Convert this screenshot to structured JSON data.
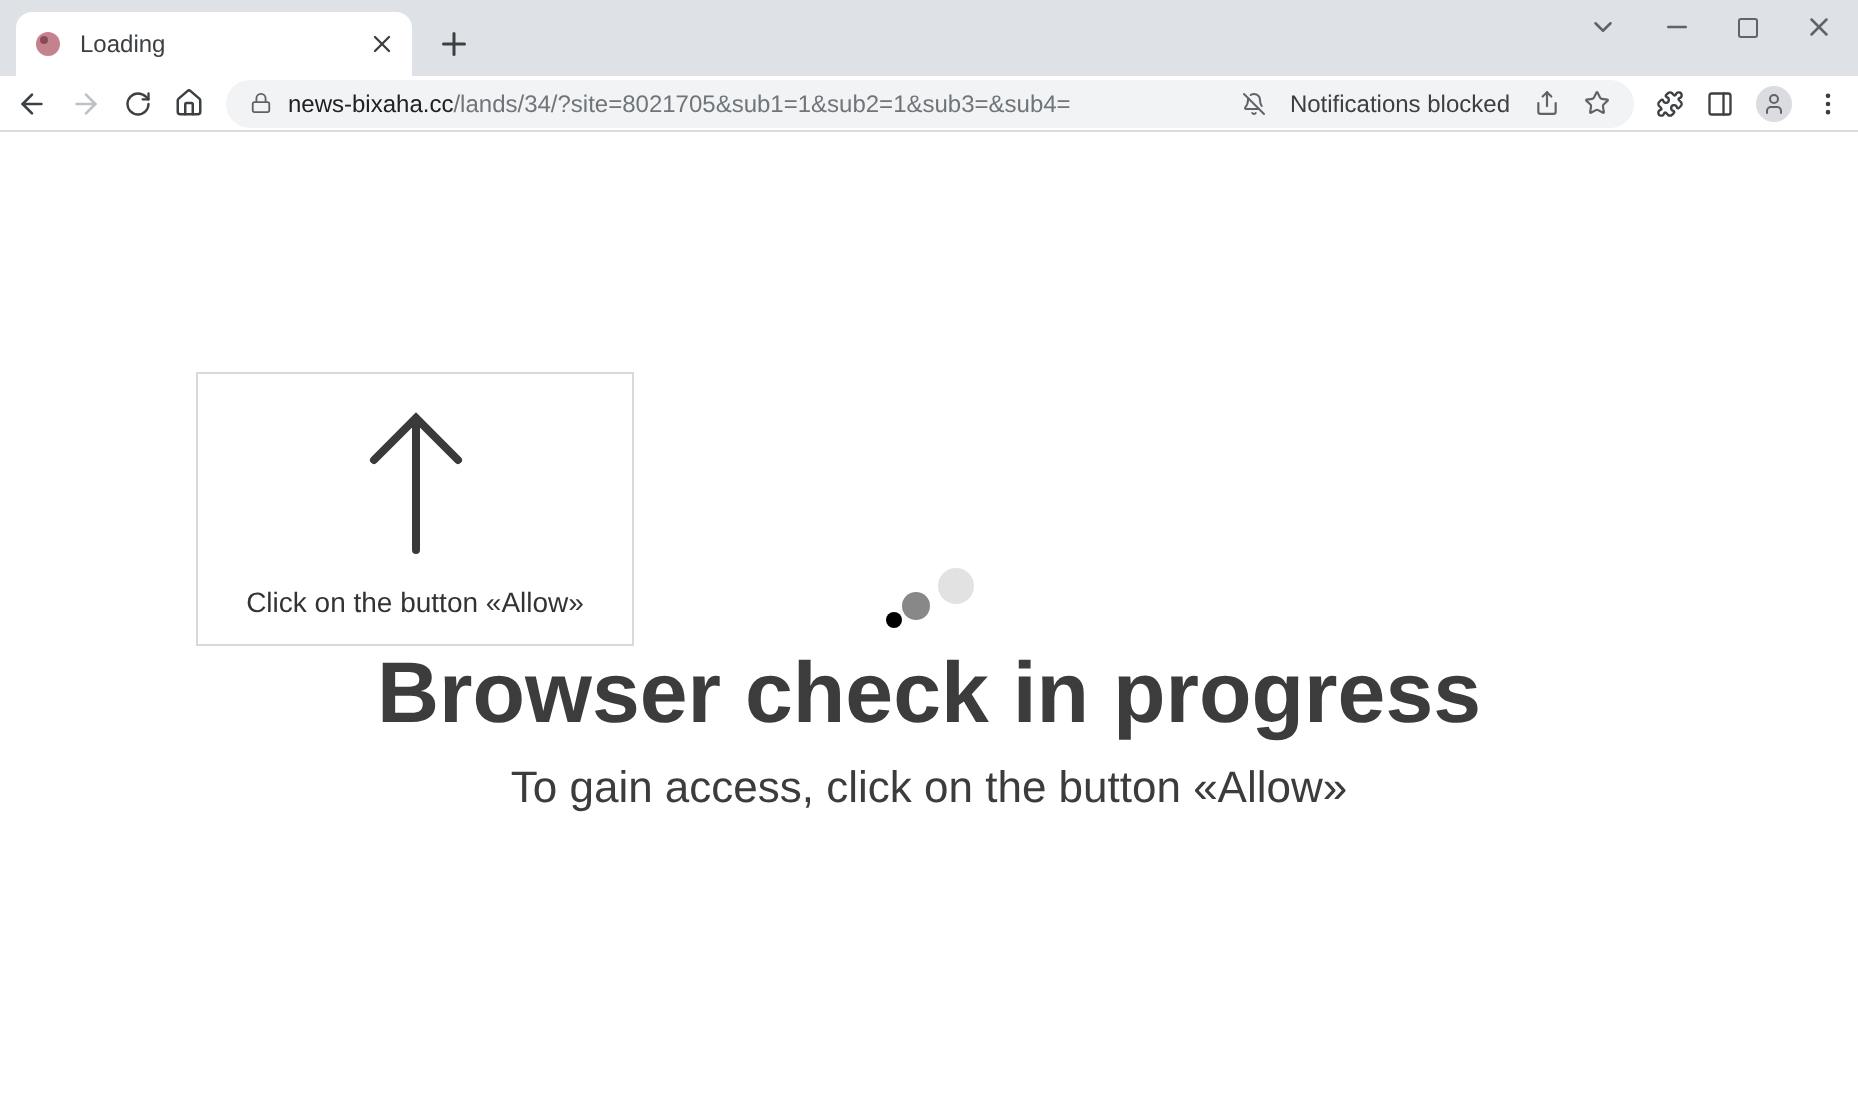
{
  "tabs": [
    {
      "title": "Loading",
      "selected": true
    }
  ],
  "address_bar": {
    "host": "news-bixaha.cc",
    "path": "/lands/34/?site=8021705&sub1=1&sub2=1&sub3=&sub4=",
    "notification_chip": "Notifications blocked"
  },
  "prompt_card": {
    "text": "Click on the button «Allow»"
  },
  "heading": "Browser check in progress",
  "subheading": "To gain access, click on the button «Allow»"
}
